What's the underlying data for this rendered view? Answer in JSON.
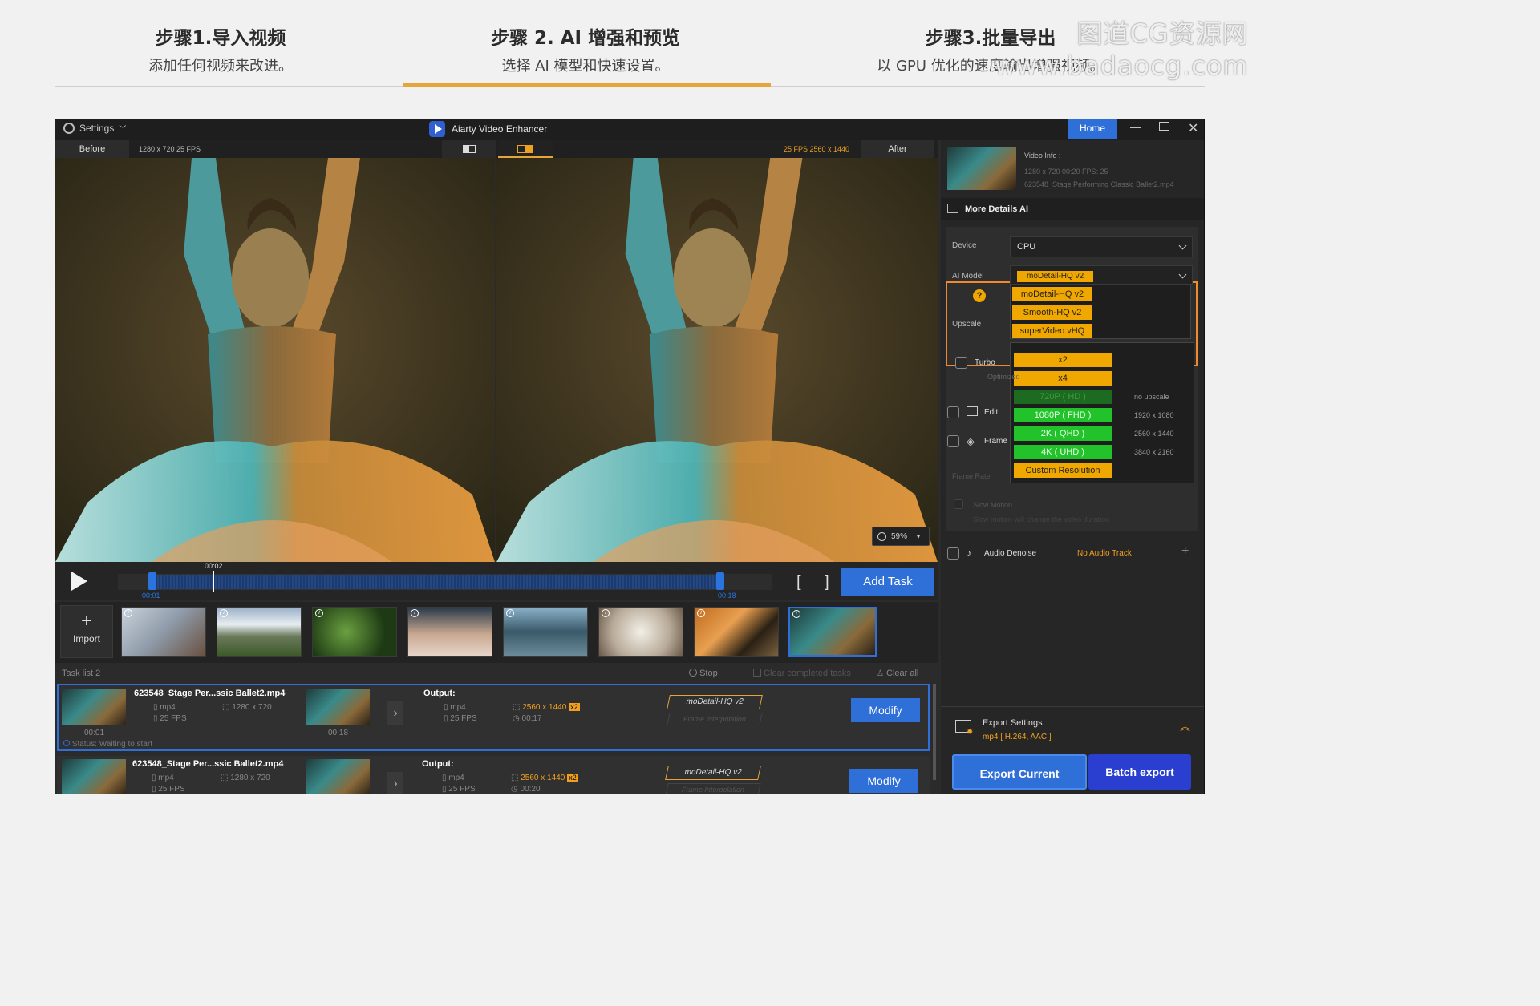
{
  "steps": [
    {
      "title": "步骤1.导入视频",
      "subtitle": "添加任何视频来改进。"
    },
    {
      "title": "步骤 2. AI 增强和预览",
      "subtitle": "选择 AI 模型和快速设置。"
    },
    {
      "title": "步骤3.批量导出",
      "subtitle": "以 GPU 优化的速度输出增强视频。"
    }
  ],
  "watermark": {
    "line1": "图道CG资源网",
    "line2": "www.badaocg.com"
  },
  "titlebar": {
    "settings": "Settings",
    "app_title": "Aiarty Video Enhancer",
    "home": "Home"
  },
  "preview": {
    "before_label": "Before",
    "before_info": "1280 x 720  25 FPS",
    "after_info": "25 FPS  2560 x 1440",
    "after_label": "After",
    "zoom": "59%"
  },
  "transport": {
    "current_time": "00:02",
    "start_time": "00:01",
    "end_time": "00:18",
    "add_task": "Add Task"
  },
  "thumbs": {
    "import_label": "Import",
    "info_glyph": "i"
  },
  "tasklist": {
    "label": "Task list  2",
    "stop": "Stop",
    "clear_completed": "Clear completed tasks",
    "clear_all": "Clear all",
    "tasks": [
      {
        "name": "623548_Stage Per...ssic Ballet2.mp4",
        "format": "mp4",
        "res": "1280 x 720",
        "fps": "25 FPS",
        "t_start": "00:01",
        "t_end": "00:18",
        "output_label": "Output:",
        "out_format": "mp4",
        "out_res": "2560 x 1440",
        "out_scale": "x2",
        "out_fps": "25 FPS",
        "out_dur": "00:17",
        "model": "moDetail-HQ  v2",
        "frame_interp": "Frame Interpolation",
        "modify": "Modify",
        "status": "Status: Waiting to start"
      },
      {
        "name": "623548_Stage Per...ssic Ballet2.mp4",
        "format": "mp4",
        "res": "1280 x 720",
        "fps": "25 FPS",
        "output_label": "Output:",
        "out_format": "mp4",
        "out_res": "2560 x 1440",
        "out_scale": "x2",
        "out_fps": "25 FPS",
        "out_dur": "00:20",
        "model": "moDetail-HQ  v2",
        "frame_interp": "Frame Interpolation",
        "modify": "Modify"
      }
    ]
  },
  "panel": {
    "video_info_label": "Video Info :",
    "video_info_meta": "1280 x 720  00:20   FPS: 25",
    "video_info_file": "623548_Stage Performing Classic Ballet2.mp4",
    "more_details": "More Details AI",
    "device_label": "Device",
    "device_value": "CPU",
    "ai_model_label": "AI Model",
    "ai_model_value": "moDetail-HQ  v2",
    "models": [
      "moDetail-HQ  v2",
      "Smooth-HQ  v2",
      "superVideo vHQ"
    ],
    "question": "?",
    "upscale_label": "Upscale",
    "scales": [
      "x2",
      "x4"
    ],
    "resolutions": [
      {
        "label": "720P  ( HD )",
        "res": "no upscale",
        "dim": true
      },
      {
        "label": "1080P  ( FHD )",
        "res": "1920 x 1080",
        "dim": false
      },
      {
        "label": "2K  ( QHD )",
        "res": "2560 x 1440",
        "dim": false
      },
      {
        "label": "4K  ( UHD )",
        "res": "3840 x 2160",
        "dim": false
      }
    ],
    "custom_resolution": "Custom Resolution",
    "turbo": "Turbo",
    "optimized": "Optimized",
    "edit": "Edit",
    "frame": "Frame",
    "frame_rate": "Frame Rate",
    "slow_motion": "Slow Motion",
    "slow_motion_note": "Slow motion will change the video duration",
    "audio_denoise": "Audio Denoise",
    "no_audio_track": "No Audio Track",
    "export_settings": "Export Settings",
    "export_format": "mp4 [ H.264, AAC ]",
    "export_current": "Export Current",
    "batch_export": "Batch export"
  },
  "colors": {
    "accent": "#2f6fd8",
    "highlight": "#f08a2e",
    "model_yellow": "#f0a800",
    "res_green": "#22c22a"
  }
}
